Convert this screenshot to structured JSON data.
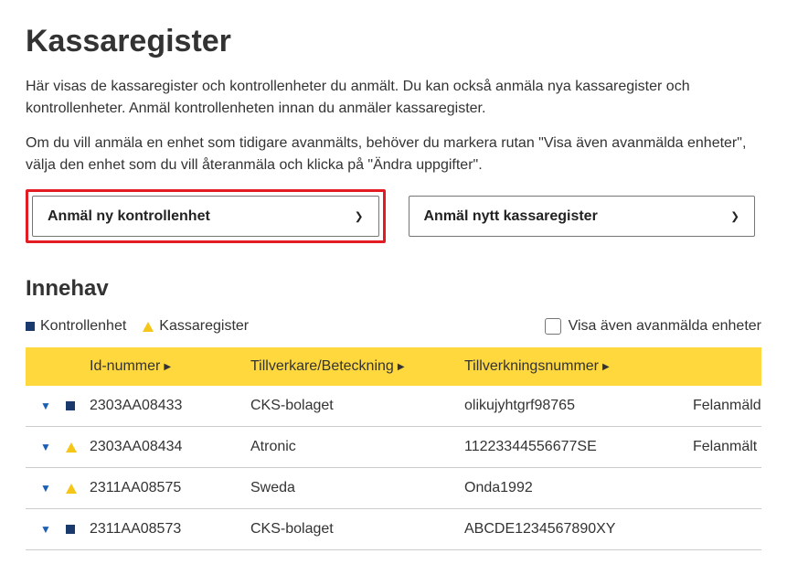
{
  "page_title": "Kassaregister",
  "intro1": "Här visas de kassaregister och kontrollenheter du anmält. Du kan också anmäla nya kassaregister och kontrollenheter. Anmäl kontrollenheten innan du anmäler kassaregister.",
  "intro2": "Om du vill anmäla en enhet som tidigare avanmälts, behöver du markera rutan \"Visa även avanmälda enheter\", välja den enhet som du vill återanmäla och klicka på \"Ändra uppgifter\".",
  "actions": {
    "new_control_unit": "Anmäl ny kontrollenhet",
    "new_register": "Anmäl nytt kassaregister"
  },
  "holdings_title": "Innehav",
  "legend": {
    "control_unit": "Kontrollenhet",
    "register": "Kassaregister",
    "show_deregistered": "Visa även avanmälda enheter"
  },
  "columns": {
    "id": "Id-nummer",
    "mfr": "Tillverkare/Beteckning",
    "serial": "Tillverkningsnummer"
  },
  "rows": [
    {
      "icon": "square",
      "id": "2303AA08433",
      "mfr": "CKS-bolaget",
      "serial": "olikujyhtgrf98765",
      "status": "Felanmäld"
    },
    {
      "icon": "triangle",
      "id": "2303AA08434",
      "mfr": "Atronic",
      "serial": "11223344556677SE",
      "status": "Felanmält"
    },
    {
      "icon": "triangle",
      "id": "2311AA08575",
      "mfr": "Sweda",
      "serial": "Onda1992",
      "status": ""
    },
    {
      "icon": "square",
      "id": "2311AA08573",
      "mfr": "CKS-bolaget",
      "serial": "ABCDE1234567890XY",
      "status": ""
    }
  ]
}
